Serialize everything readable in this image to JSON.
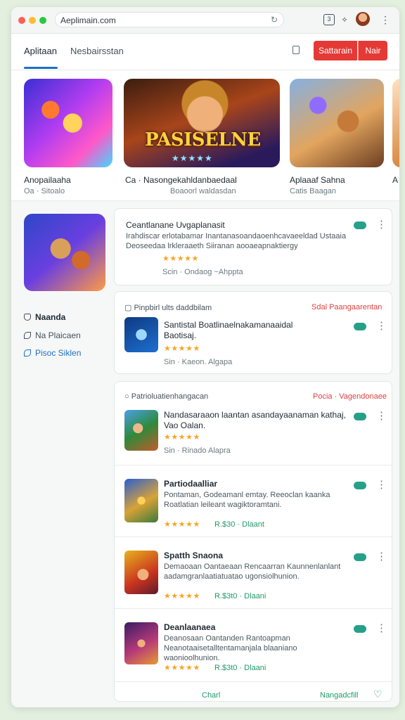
{
  "browser": {
    "url": "Aeplimain.com"
  },
  "nav": {
    "tab_active": "Aplitaan",
    "tab_other": "Nesbairsstan",
    "btn_primary": "Sattarain",
    "btn_secondary": "Nair"
  },
  "carousel": [
    {
      "title": "Anopailaaha",
      "sub": "Oa · Sitoalo"
    },
    {
      "title": "Ca · Nasongekahldanbaedaal",
      "sub": "Boaoorl waldasdan",
      "banner": "PASISELNE",
      "banner_stars": "★★★★★"
    },
    {
      "title": "Aplaaaf Sahna",
      "sub": "Catis Baagan"
    },
    {
      "title": "A",
      "sub": ""
    }
  ],
  "sidebar": {
    "item1": "Naanda",
    "item2": "Na Plaicaen",
    "item3": "Pisoc Siklen"
  },
  "featured": {
    "title": "Ceantlanane Uvgaplanasit",
    "desc": "Irahdiscar erlotabamar Inantanasoandaoenhcavaeeldad Ustaaia Deoseedaa lrkleraaeth Siiranan aooaeapnaktiergy",
    "stars": "★★★★★",
    "meta": "Scin · Ondaog ~Ahppta"
  },
  "section1": {
    "header": "Pinpbirl ults daddbilam",
    "link": "Sdal Paangaarentan",
    "row": {
      "title": "Santistal Boatlinaelnakamanaaidal Baotisaj.",
      "stars": "★★★★★",
      "meta": "Sin · Kaeon. Algapa"
    }
  },
  "section2": {
    "header": "Patrioluatienhangacan",
    "link": "Pocia · Vagendonaee",
    "rows": [
      {
        "title": "Nandasaraaon laantan asandayaanaman kathaj, Vao Oalan.",
        "desc": "",
        "stars": "★★★★★",
        "meta": "Sin · Rinado Alapra"
      },
      {
        "title": "Partiodaalliar",
        "desc": "Pontaman, Godeamanl emtay. Reeoclan kaanka Roatlatian leileant wagiktoramtani.",
        "stars": "★★★★★",
        "meta": "R.$30 · Dlaant"
      },
      {
        "title": "Spatth Snaona",
        "desc": "Demaoaan Oantaeaan Rencaarran Kaunnenlanlant aadamgranlaatiatuatao ugonsiolhunion.",
        "stars": "★★★★★",
        "meta": "R.$3t0 · Dlaani"
      },
      {
        "title": "Deanlaanaea",
        "desc": "Deanosaan Oantanden Rantoapman Neanotaaisetalltentamanjala blaaniano waonioolhunion.",
        "stars": "★★★★★",
        "meta": "R.$3t0 · Dlaani"
      }
    ],
    "footer_left": "Charl",
    "footer_right": "Nangadcfill"
  }
}
